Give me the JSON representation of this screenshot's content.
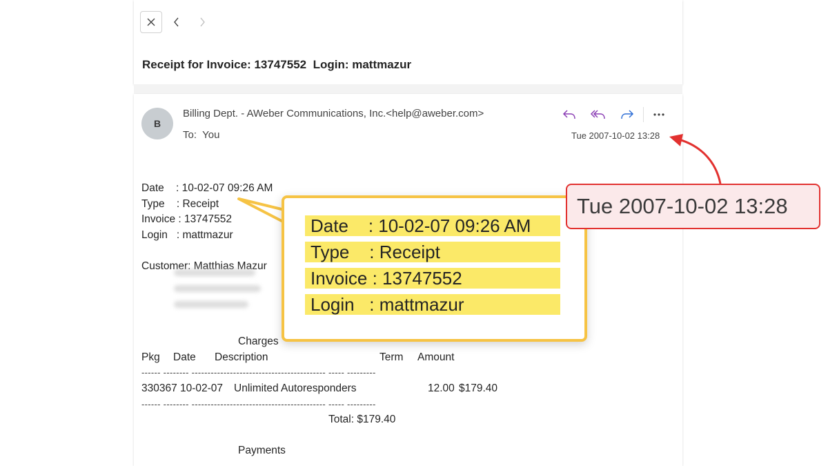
{
  "header": {
    "subject": "Receipt for Invoice: 13747552  Login: mattmazur"
  },
  "message": {
    "avatar_initial": "B",
    "sender": "Billing Dept. - AWeber Communications, Inc.<help@aweber.com>",
    "to_label": "To:",
    "to_value": "You",
    "timestamp": "Tue 2007-10-02 13:28",
    "body": {
      "date_line": "Date    : 10-02-07 09:26 AM",
      "type_line": "Type    : Receipt",
      "invoice_line": "Invoice : 13747552",
      "login_line": "Login   : mattmazur",
      "customer_line": "Customer: Matthias Mazur"
    },
    "charges": {
      "title": "Charges",
      "headers": {
        "pkg": "Pkg",
        "date": "Date",
        "description": "Description",
        "term": "Term",
        "amount": "Amount"
      },
      "separator": "------ -------- ------------------------------------------ ----- ---------",
      "row": {
        "pkg": "330367",
        "date": "10-02-07",
        "description": "Unlimited Autoresponders",
        "term": "12.00",
        "amount": "$179.40"
      },
      "total": "Total: $179.40"
    },
    "payments_title": "Payments"
  },
  "callout": {
    "lines": [
      "Date    : 10-02-07 09:26 AM",
      "Type    : Receipt",
      "Invoice : 13747552",
      "Login   : mattmazur"
    ],
    "highlight_color": "#fbe968",
    "border_color": "#f6c344"
  },
  "date_badge": {
    "text": "Tue 2007-10-02 13:28",
    "border_color": "#e2312f"
  },
  "icons": {
    "close": "close-icon",
    "back": "chevron-left-icon",
    "forward": "chevron-right-icon",
    "reply": "reply-icon",
    "reply_all": "reply-all-icon",
    "forward_msg": "forward-icon",
    "more": "more-icon"
  },
  "colors": {
    "reply_accent": "#8b3fb5",
    "forward_accent": "#2f6fd6"
  }
}
